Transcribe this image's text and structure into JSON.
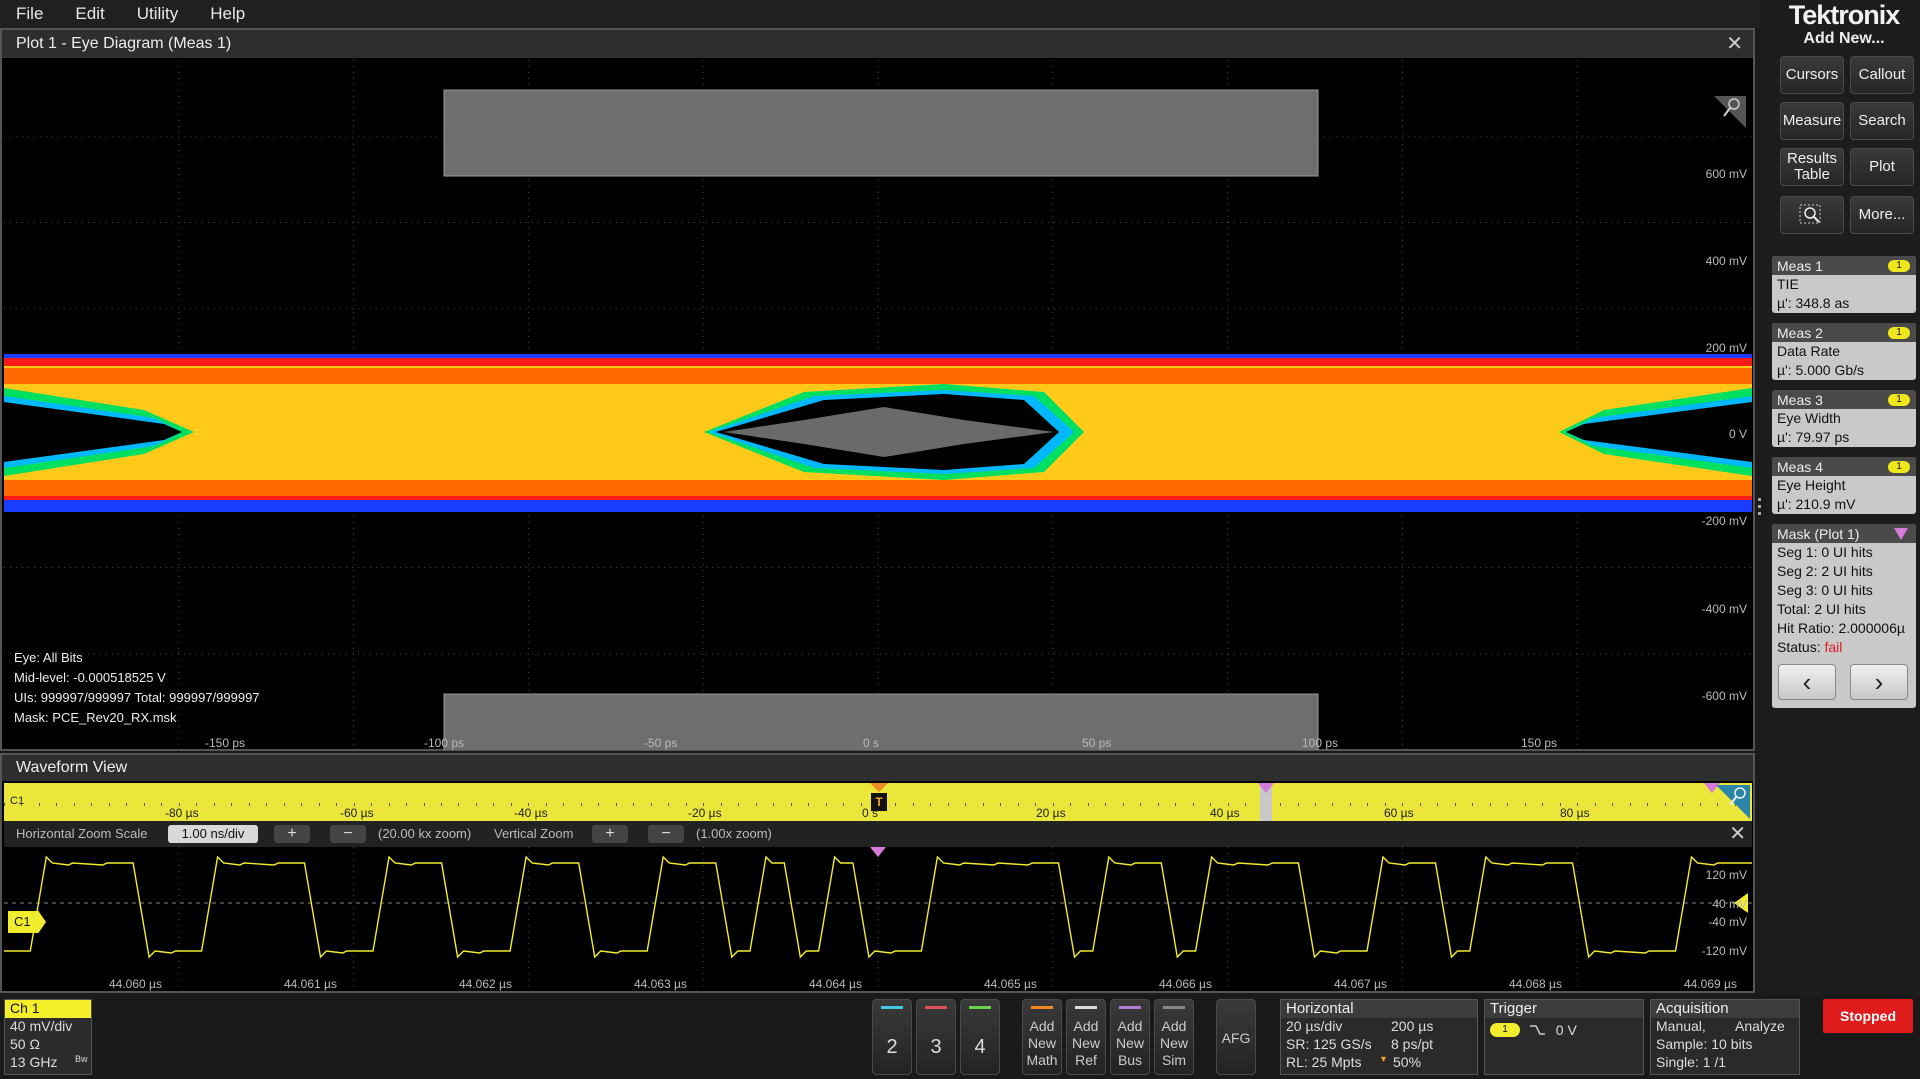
{
  "menu": [
    "File",
    "Edit",
    "Utility",
    "Help"
  ],
  "brand": "Tektronix",
  "right_panel": {
    "add_new": "Add New...",
    "buttons": [
      "Cursors",
      "Callout",
      "Measure",
      "Search",
      "Results Table",
      "Plot",
      "More..."
    ],
    "measurements": [
      {
        "name": "Meas 1",
        "badge": "1",
        "type": "TIE",
        "value": "µ': 348.8 as"
      },
      {
        "name": "Meas 2",
        "badge": "1",
        "type": "Data Rate",
        "value": "µ': 5.000 Gb/s"
      },
      {
        "name": "Meas 3",
        "badge": "1",
        "type": "Eye Width",
        "value": "µ': 79.97 ps"
      },
      {
        "name": "Meas 4",
        "badge": "1",
        "type": "Eye Height",
        "value": "µ': 210.9 mV"
      }
    ],
    "mask": {
      "title": "Mask (Plot 1)",
      "lines": [
        "Seg 1: 0 UI hits",
        "Seg 2: 2 UI hits",
        "Seg 3: 0 UI hits",
        "Total: 2 UI hits",
        "Hit Ratio: 2.000006µ"
      ],
      "status_label": "Status:",
      "status_value": "fail"
    },
    "nav": {
      "prev": "‹",
      "next": "›"
    }
  },
  "plot": {
    "title": "Plot 1 - Eye Diagram (Meas 1)",
    "close": "✕",
    "y_labels": [
      "600 mV",
      "400 mV",
      "200 mV",
      "0 V",
      "-200 mV",
      "-400 mV",
      "-600 mV"
    ],
    "x_labels": [
      "-150 ps",
      "-100 ps",
      "-50 ps",
      "0 s",
      "50 ps",
      "100 ps",
      "150 ps"
    ],
    "info": {
      "eye": "Eye:   All Bits",
      "midlevel": "Mid-level:   -0.000518525 V",
      "uis": "UIs:   999997/999997   Total:   999997/999997",
      "mask": "Mask:   PCE_Rev20_RX.msk"
    }
  },
  "waveform": {
    "title": "Waveform View",
    "close": "✕",
    "overview_channel": "C1",
    "overview_labels": [
      "-80 µs",
      "-60 µs",
      "-40 µs",
      "-20 µs",
      "0 s",
      "20 µs",
      "40 µs",
      "60 µs",
      "80 µs"
    ],
    "trigger_marker": "T",
    "zoom": {
      "h_label": "Horizontal Zoom Scale",
      "h_value": "1.00 ns/div",
      "plus": "+",
      "minus": "−",
      "h_zoom": "(20.00 kx zoom)",
      "v_label": "Vertical Zoom",
      "v_zoom": "(1.00x zoom)"
    },
    "channel_marker": "C1",
    "y_labels": [
      "120 mV",
      "40 mV",
      "-40 mV",
      "-120 mV"
    ],
    "x_labels": [
      "44.060 µs",
      "44.061 µs",
      "44.062 µs",
      "44.063 µs",
      "44.064 µs",
      "44.065 µs",
      "44.066 µs",
      "44.067 µs",
      "44.068 µs",
      "44.069 µs"
    ],
    "bits": [
      0,
      1,
      1,
      1,
      0,
      0,
      1,
      1,
      1,
      0,
      0,
      1,
      1,
      0,
      0,
      1,
      1,
      0,
      0,
      1,
      1,
      0,
      1,
      0,
      1,
      0,
      0,
      1,
      1,
      1,
      1,
      0,
      1,
      1,
      0,
      1,
      1,
      1,
      0,
      0,
      1,
      1,
      0,
      1,
      1,
      1,
      0,
      0,
      0,
      1,
      1
    ],
    "colors": {
      "trace": "#f2ec2e"
    }
  },
  "bottom": {
    "ch1": {
      "label": "Ch 1",
      "lines": [
        "40 mV/div",
        "50 Ω",
        "13 GHz"
      ],
      "bw": "Bw"
    },
    "channel_buttons": [
      {
        "label": "2",
        "color": "#3fc8e6"
      },
      {
        "label": "3",
        "color": "#e0505a"
      },
      {
        "label": "4",
        "color": "#6bd24b"
      }
    ],
    "add_buttons": [
      {
        "lines": [
          "Add",
          "New",
          "Math"
        ],
        "color": "#f08a24"
      },
      {
        "lines": [
          "Add",
          "New",
          "Ref"
        ],
        "color": "#dcdcdc"
      },
      {
        "lines": [
          "Add",
          "New",
          "Bus"
        ],
        "color": "#b07ad6"
      },
      {
        "lines": [
          "Add",
          "New",
          "Sim"
        ],
        "color": "#888888"
      }
    ],
    "afg": "AFG",
    "horizontal": {
      "title": "Horizontal",
      "rows": [
        [
          "20 µs/div",
          "200 µs"
        ],
        [
          "SR: 125 GS/s",
          "8 ps/pt"
        ],
        [
          "RL: 25 Mpts",
          "50%"
        ]
      ]
    },
    "trigger": {
      "title": "Trigger",
      "badge": "1",
      "level": "0 V"
    },
    "acquisition": {
      "title": "Acquisition",
      "rows": [
        [
          "Manual,",
          "Analyze"
        ],
        [
          "Sample: 10 bits",
          ""
        ],
        [
          "Single: 1 /1",
          ""
        ]
      ]
    },
    "run_state": "Stopped"
  }
}
